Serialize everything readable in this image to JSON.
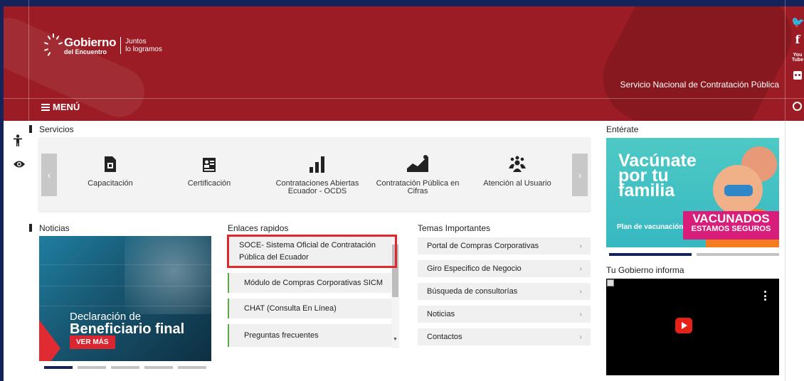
{
  "header": {
    "logo": {
      "main": "Gobierno",
      "sub": "del Encuentro",
      "slogan_line1": "Juntos",
      "slogan_line2": "lo logramos"
    },
    "site_title": "Servicio Nacional de Contratación Pública",
    "menu_label": "MENÚ",
    "brand_color": "#9b1c24",
    "social_icons": [
      "twitter-icon",
      "facebook-icon",
      "youtube-icon",
      "flickr-icon"
    ]
  },
  "tools": [
    "accessibility-icon",
    "eye-icon"
  ],
  "services": {
    "title": "Servicios",
    "items": [
      {
        "label": "Capacitación",
        "icon": "document-certificate-icon"
      },
      {
        "label": "Certificación",
        "icon": "id-card-icon"
      },
      {
        "label": "Contrataciones Abiertas Ecuador - OCDS",
        "icon": "bar-chart-icon"
      },
      {
        "label": "Contratación Pública en Cifras",
        "icon": "line-chart-icon"
      },
      {
        "label": "Atención al Usuario",
        "icon": "users-icon"
      }
    ]
  },
  "news": {
    "title": "Noticias",
    "slide_line1": "Declaración de",
    "slide_line2": "Beneficiario final",
    "slide_button": "VER MÁS"
  },
  "quick_links": {
    "title": "Enlaces rapidos",
    "items": [
      "SOCE- Sistema Oficial de Contratación Pública del Ecuador",
      "Módulo de Compras Corporativas SICM",
      "CHAT (Consulta En Línea)",
      "Preguntas frecuentes"
    ]
  },
  "topics": {
    "title": "Temas Importantes",
    "items": [
      "Portal de Compras Corporativas",
      "Giro Especifico de Negocio",
      "Búsqueda de consultorías",
      "Noticias",
      "Contactos"
    ]
  },
  "enterate": {
    "title": "Entérate",
    "banner_line1": "Vacúnate",
    "banner_line2": "por tu",
    "banner_line3": "familia",
    "badge_line1": "VACUNADOS",
    "badge_line2": "ESTAMOS SEGUROS",
    "plan_text": "Plan de vacunación"
  },
  "info": {
    "title": "Tu Gobierno informa"
  }
}
